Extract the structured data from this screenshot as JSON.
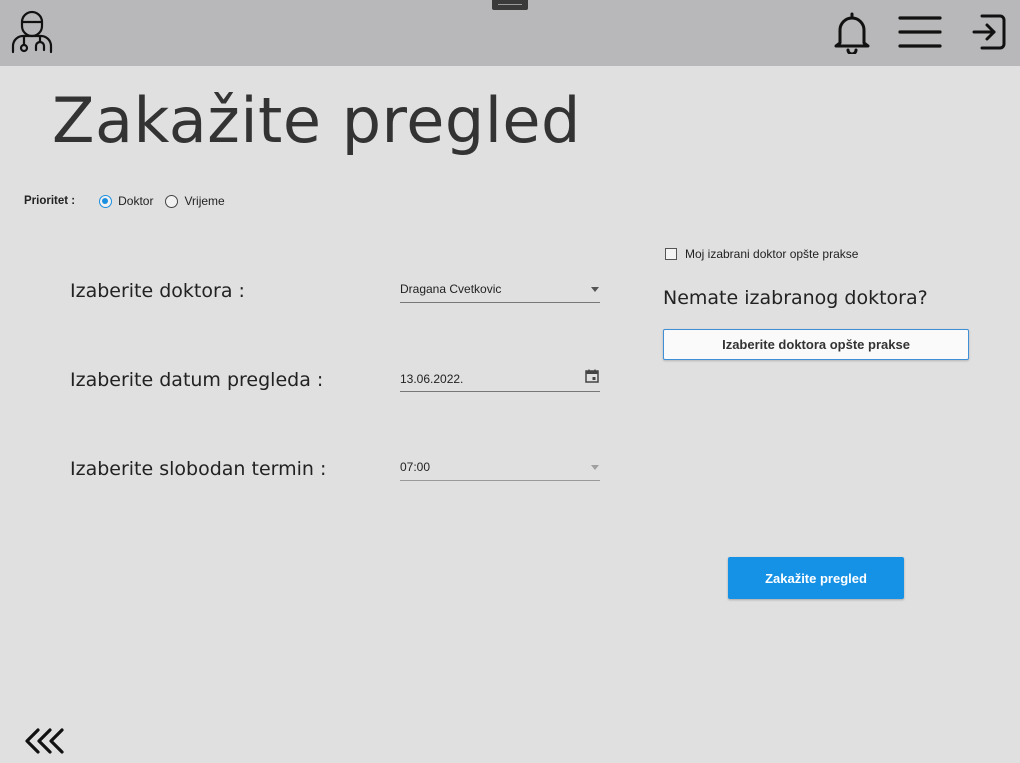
{
  "header": {
    "icons": [
      "doctor-icon",
      "bell-icon",
      "menu-icon",
      "logout-icon"
    ]
  },
  "page": {
    "title": "Zakažite pregled"
  },
  "priority": {
    "label": "Prioritet :",
    "options": [
      {
        "label": "Doktor",
        "selected": true
      },
      {
        "label": "Vrijeme",
        "selected": false
      }
    ]
  },
  "form": {
    "doctor_label": "Izaberite doktora :",
    "doctor_value": "Dragana Cvetkovic",
    "date_label": "Izaberite datum pregleda :",
    "date_value": "13.06.2022.",
    "slot_label": "Izaberite slobodan termin :",
    "slot_value": "07:00"
  },
  "side": {
    "checkbox_label": "Moj izabrani doktor opšte prakse",
    "checkbox_checked": false,
    "no_doctor_text": "Nemate izabranog doktora?",
    "choose_gp_button": "Izaberite doktora opšte prakse"
  },
  "actions": {
    "submit_label": "Zakažite pregled"
  },
  "colors": {
    "accent": "#1592e6",
    "background": "#e0e0e0",
    "topbar": "#b8b8ba"
  }
}
